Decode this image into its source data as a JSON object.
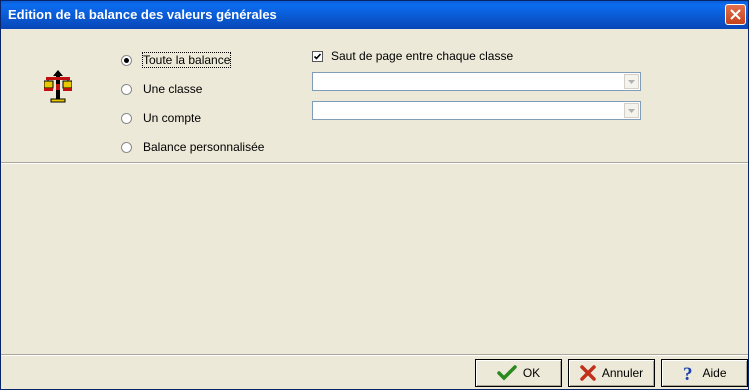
{
  "window": {
    "title": "Edition de la balance des valeurs générales"
  },
  "options": {
    "radios": [
      {
        "label": "Toute la balance",
        "checked": true
      },
      {
        "label": "Une classe",
        "checked": false
      },
      {
        "label": "Un compte",
        "checked": false
      },
      {
        "label": "Balance personnalisée",
        "checked": false
      }
    ],
    "page_break_checkbox": {
      "label": "Saut de page entre chaque classe",
      "checked": true
    },
    "class_combo_value": "",
    "account_combo_value": ""
  },
  "buttons": {
    "ok_label": "OK",
    "cancel_label": "Annuler",
    "help_label": "Aide"
  },
  "colors": {
    "title_bar": "#0a58d0",
    "close_button": "#d45a34",
    "ok_check": "#2a8a1e",
    "cancel_x": "#c0301a",
    "help_mark": "#1a3fb0"
  }
}
